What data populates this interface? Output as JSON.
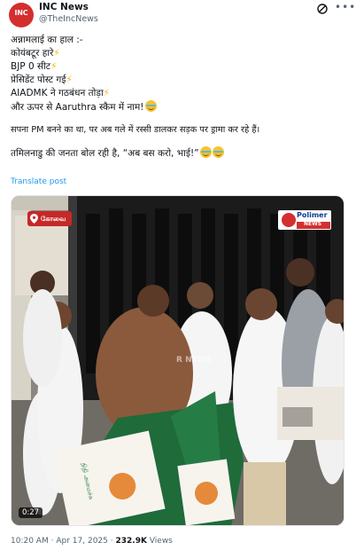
{
  "post": {
    "author_name": "INC News",
    "author_handle": "@TheIncNews",
    "avatar_text": "INC",
    "lines": [
      "अन्नामलाई का हाल :-",
      "कोयंबटूर हारे",
      "BJP 0 सीट",
      "प्रेसिडेंट पोस्ट गई",
      "AIADMK ने गठबंधन तोड़ा",
      "और ऊपर से Aaruthra स्कैम में नाम!",
      "सपना PM बनने का था, पर अब गले में रस्सी डालकर सड़क पर ड्रामा कर रहे हैं।",
      "तमिलनाडु की जनता बोल रही है, “अब बस करो, भाई!”"
    ],
    "translate_label": "Translate post"
  },
  "video": {
    "location_tag": "கோவை",
    "channel_logo": "Polimer",
    "channel_logo_sub": "NEWS",
    "watermark": "R NEWS",
    "duration": "0:27",
    "banner_text": "நிதி அமைச்சு"
  },
  "meta": {
    "time": "10:20 AM",
    "separator": "·",
    "date": "Apr 17, 2025",
    "views_count": "232.9K",
    "views_label": "Views"
  },
  "colors": {
    "link": "#1d9bf0",
    "secondary_text": "#536471",
    "brand_red": "#d32f2f",
    "dhoti_green": "#1f6b3a"
  },
  "icons": [
    "grok-icon",
    "more-icon",
    "lightning-icon",
    "laughing-emoji",
    "location-pin-icon"
  ]
}
